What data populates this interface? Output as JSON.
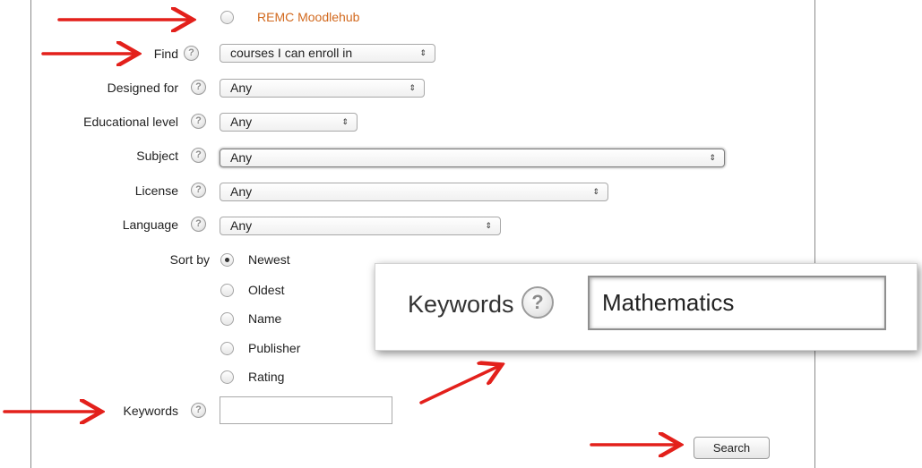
{
  "hub": {
    "label": "REMC Moodlehub"
  },
  "filters": {
    "find": {
      "label": "Find",
      "value": "courses I can enroll in"
    },
    "designed_for": {
      "label": "Designed for",
      "value": "Any"
    },
    "educational_level": {
      "label": "Educational level",
      "value": "Any"
    },
    "subject": {
      "label": "Subject",
      "value": "Any"
    },
    "license": {
      "label": "License",
      "value": "Any"
    },
    "language": {
      "label": "Language",
      "value": "Any"
    }
  },
  "sort_by": {
    "label": "Sort by",
    "selected": "Newest",
    "options": [
      "Newest",
      "Oldest",
      "Name",
      "Publisher",
      "Rating"
    ]
  },
  "keywords": {
    "label": "Keywords",
    "value": ""
  },
  "search_button": {
    "label": "Search"
  },
  "zoom_callout": {
    "label": "Keywords",
    "value": "Mathematics"
  },
  "icons": {
    "help": "help-question-icon",
    "arrow": "red-arrow-annotation"
  },
  "colors": {
    "hub_link": "#d2691e",
    "annotation": "#e3201b",
    "panel_border": "#8a8a8a"
  }
}
